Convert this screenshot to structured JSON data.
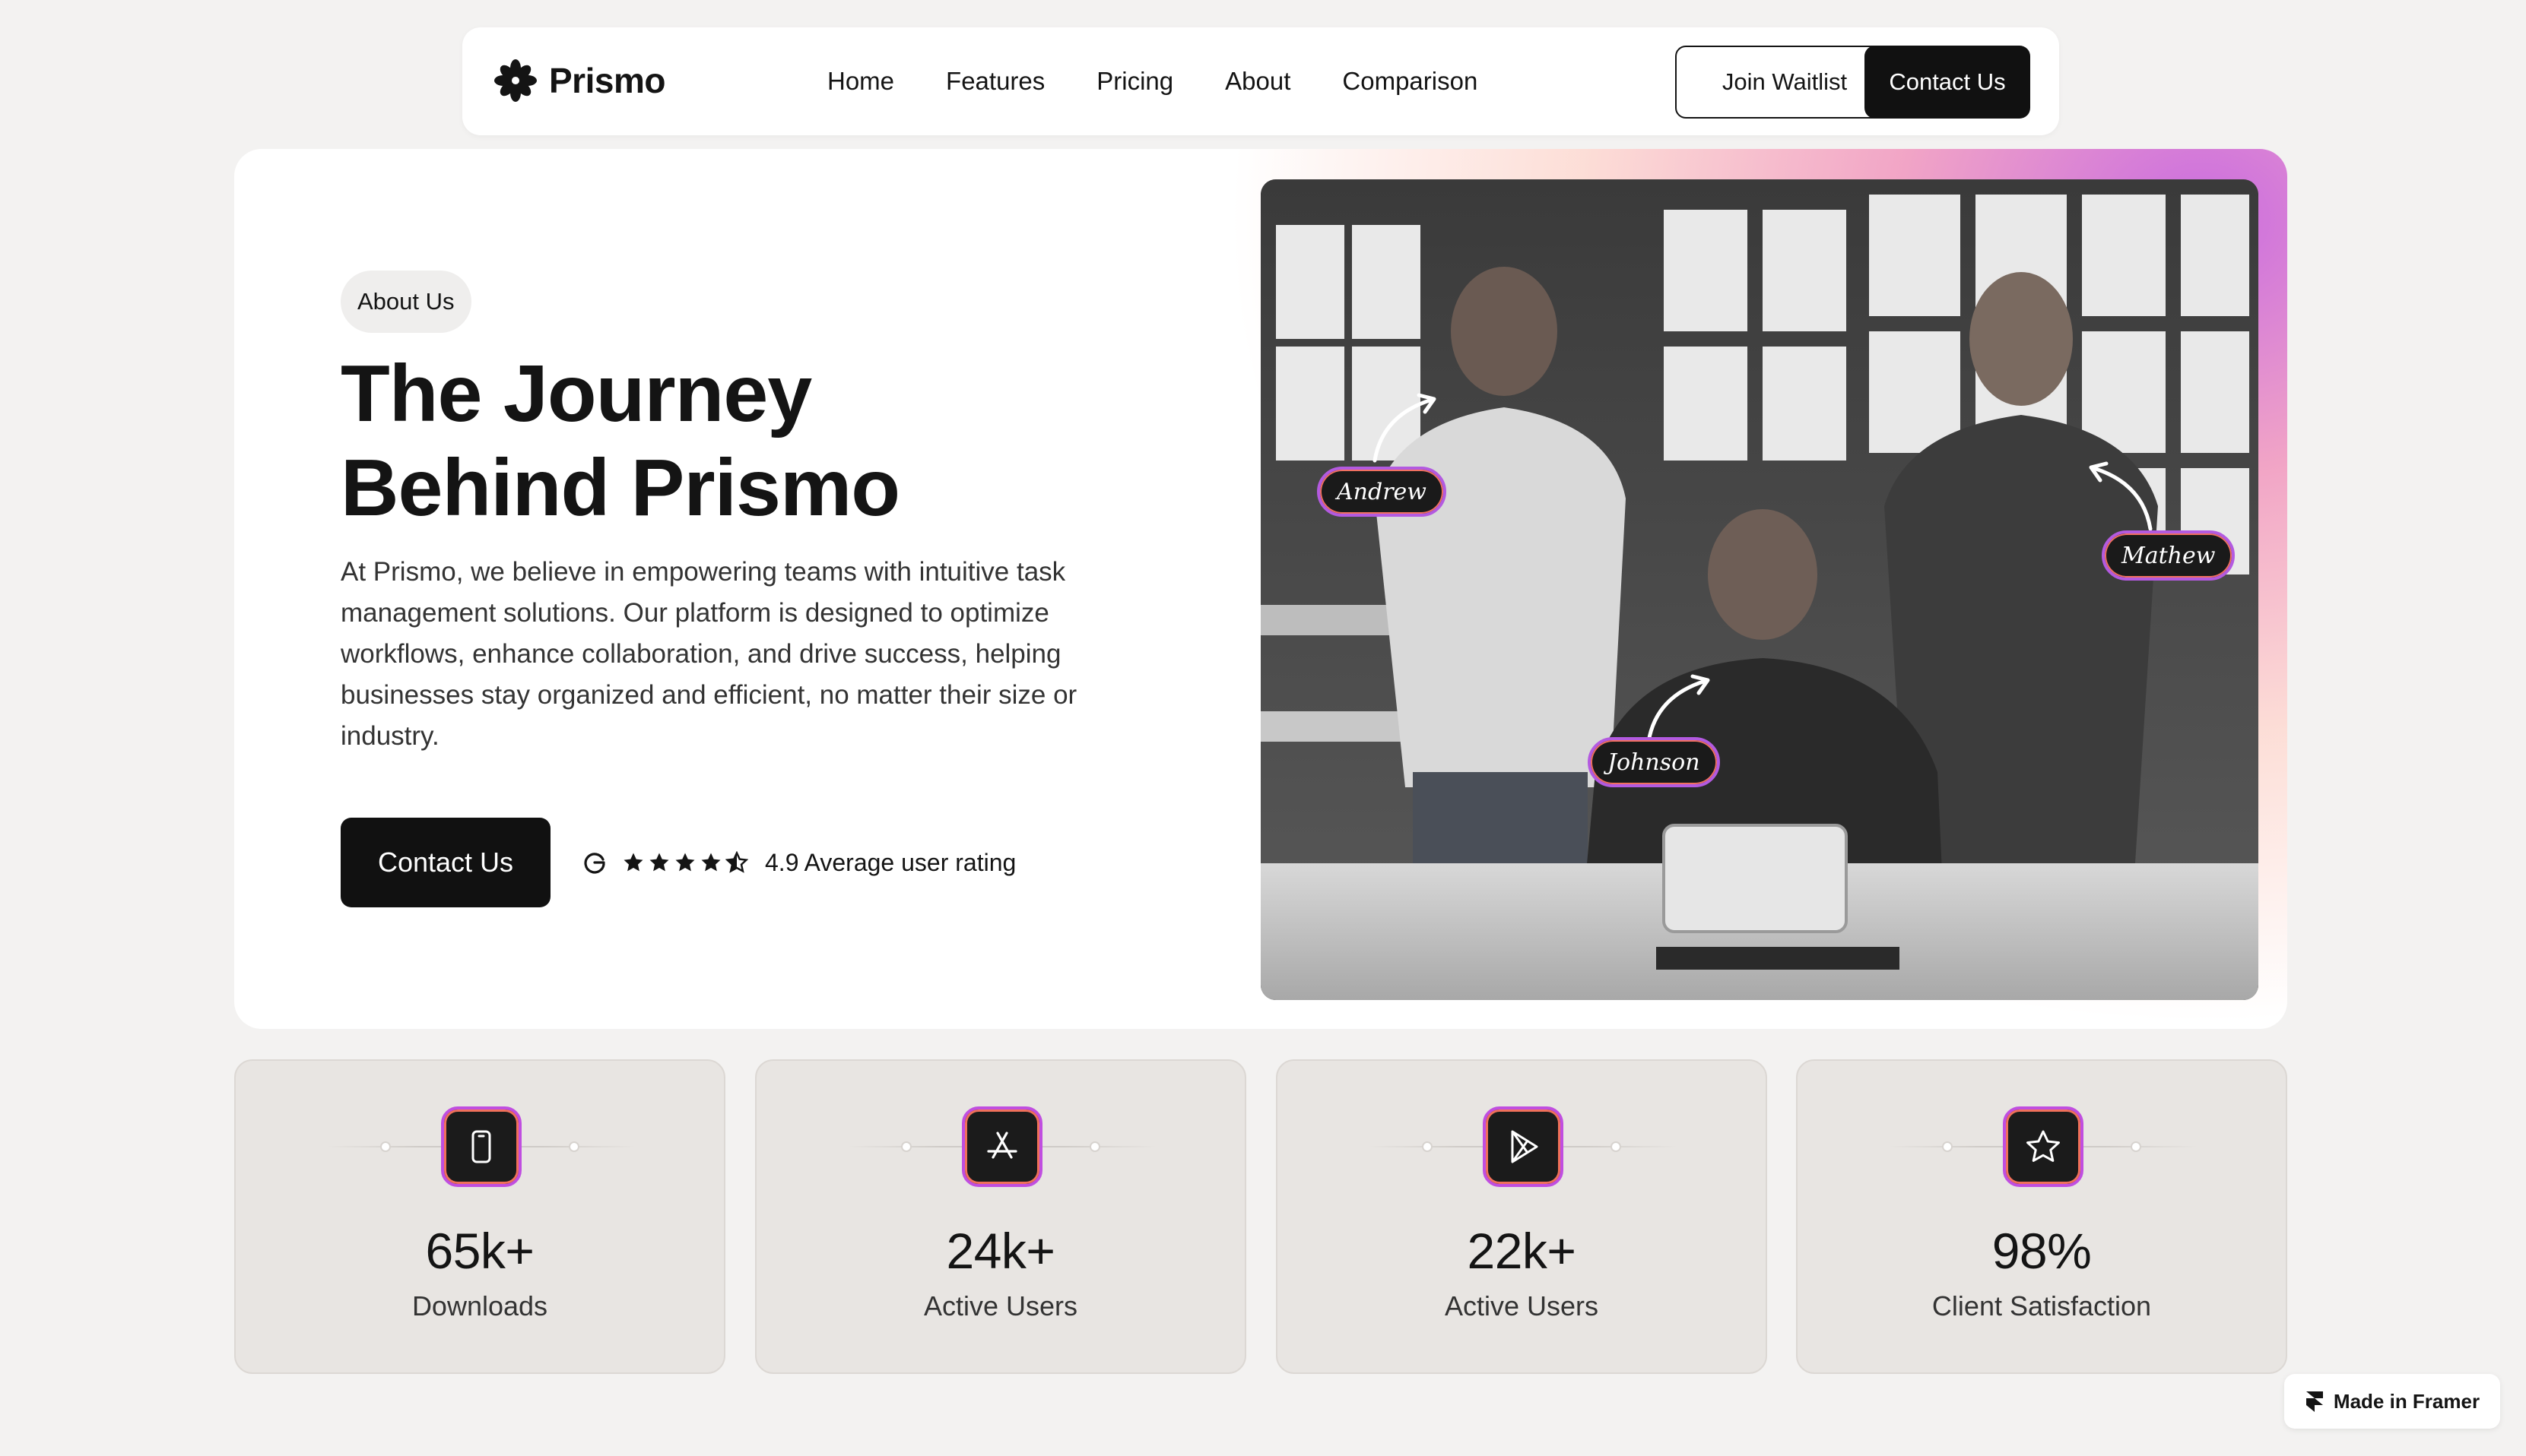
{
  "nav": {
    "brand": "Prismo",
    "links": [
      "Home",
      "Features",
      "Pricing",
      "About",
      "Comparison"
    ],
    "join_label": "Join Waitlist",
    "contact_label": "Contact Us"
  },
  "hero": {
    "pill": "About Us",
    "title_line1": "The Journey",
    "title_line2": "Behind Prismo",
    "description": "At Prismo, we believe in empowering teams with intuitive task management solutions. Our platform is designed to optimize workflows, enhance collaboration, and drive success, helping businesses stay organized and efficient, no matter their size or industry.",
    "cta_label": "Contact Us",
    "rating_text": "4.9 Average user rating",
    "rating_value": 4.5,
    "names": [
      "Andrew",
      "Johnson",
      "Mathew"
    ]
  },
  "stats": [
    {
      "value": "65k+",
      "label": "Downloads",
      "icon": "phone-icon"
    },
    {
      "value": "24k+",
      "label": "Active Users",
      "icon": "app-store-icon"
    },
    {
      "value": "22k+",
      "label": "Active Users",
      "icon": "play-store-icon"
    },
    {
      "value": "98%",
      "label": "Client Satisfaction",
      "icon": "star-icon"
    }
  ],
  "framer_badge": "Made in Framer",
  "colors": {
    "accent_purple": "#c04ee0",
    "accent_coral": "#f0705a",
    "dark": "#111111",
    "background": "#f3f2f1"
  }
}
